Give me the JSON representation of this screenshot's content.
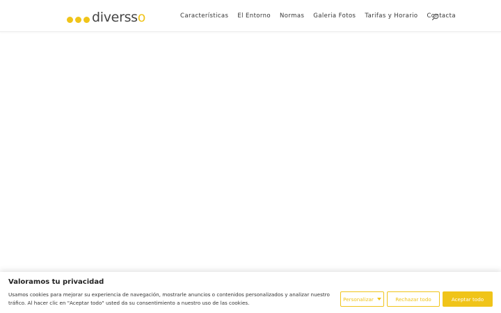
{
  "brand": {
    "name_prefix": "diverss",
    "name_suffix": "o",
    "accent": "#f0c419"
  },
  "nav": {
    "items": [
      {
        "label": "Características"
      },
      {
        "label": "El Entorno"
      },
      {
        "label": "Normas"
      },
      {
        "label": "Galeria Fotos"
      },
      {
        "label": "Tarifas y Horario"
      },
      {
        "label": "Contacta"
      }
    ],
    "search_icon": "search-icon"
  },
  "cookie_banner": {
    "title": "Valoramos tu privacidad",
    "text": "Usamos cookies para mejorar su experiencia de navegación, mostrarle anuncios o contenidos personalizados y analizar nuestro tráfico. Al hacer clic en \"Aceptar todo\" usted da su consentimiento a nuestro uso de las cookies.",
    "customize_label": "Personalizar",
    "reject_label": "Rechazar todo",
    "accept_label": "Aceptar todo"
  }
}
